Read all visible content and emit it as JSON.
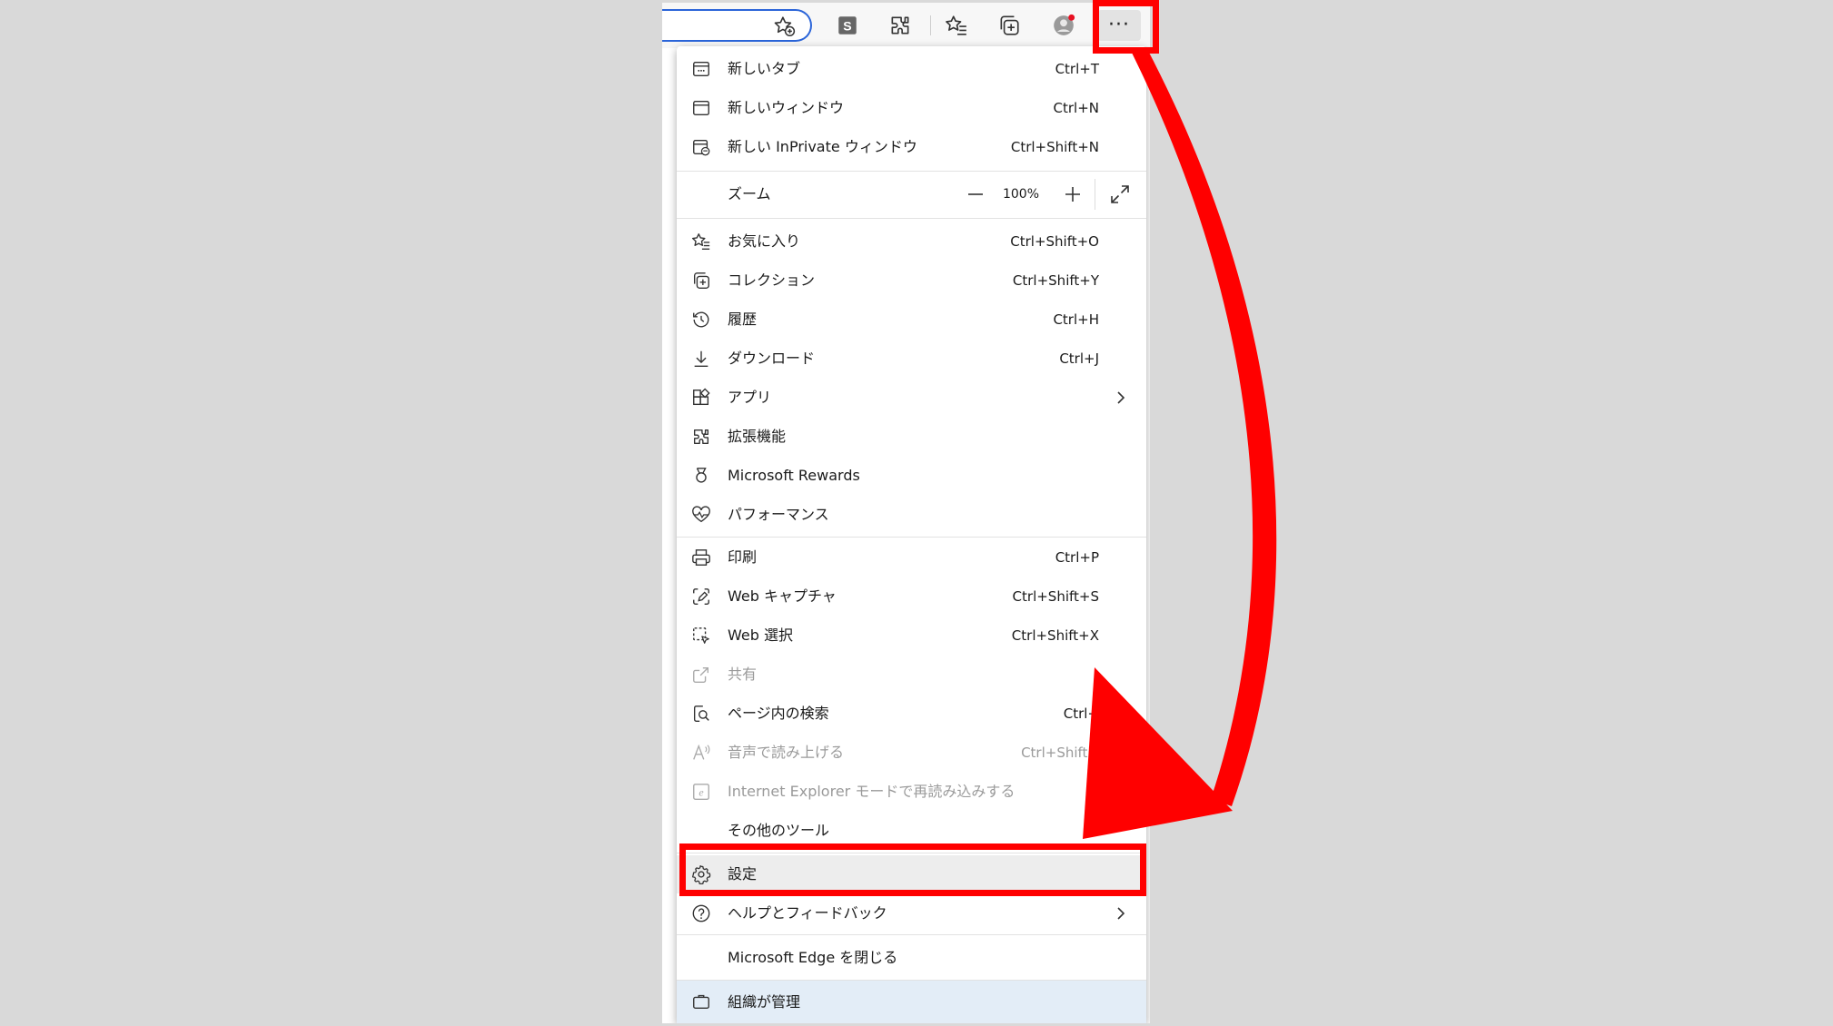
{
  "toolbar": {
    "icons": [
      "favorite-add-icon",
      "s-extension-icon",
      "extensions-icon",
      "favorites-icon",
      "collections-icon",
      "profile-icon",
      "more-icon"
    ],
    "more_label": "···"
  },
  "menu": {
    "new_tab": {
      "label": "新しいタブ",
      "shortcut": "Ctrl+T"
    },
    "new_window": {
      "label": "新しいウィンドウ",
      "shortcut": "Ctrl+N"
    },
    "inprivate": {
      "label": "新しい InPrivate ウィンドウ",
      "shortcut": "Ctrl+Shift+N"
    },
    "zoom": {
      "label": "ズーム",
      "value": "100%"
    },
    "favorites": {
      "label": "お気に入り",
      "shortcut": "Ctrl+Shift+O"
    },
    "collections": {
      "label": "コレクション",
      "shortcut": "Ctrl+Shift+Y"
    },
    "history": {
      "label": "履歴",
      "shortcut": "Ctrl+H"
    },
    "downloads": {
      "label": "ダウンロード",
      "shortcut": "Ctrl+J"
    },
    "apps": {
      "label": "アプリ"
    },
    "extensions": {
      "label": "拡張機能"
    },
    "rewards": {
      "label": "Microsoft Rewards"
    },
    "performance": {
      "label": "パフォーマンス"
    },
    "print": {
      "label": "印刷",
      "shortcut": "Ctrl+P"
    },
    "web_capture": {
      "label": "Web キャプチャ",
      "shortcut": "Ctrl+Shift+S"
    },
    "web_select": {
      "label": "Web 選択",
      "shortcut": "Ctrl+Shift+X"
    },
    "share": {
      "label": "共有"
    },
    "find": {
      "label": "ページ内の検索",
      "shortcut": "Ctrl+"
    },
    "read_aloud": {
      "label": "音声で読み上げる",
      "shortcut": "Ctrl+Shift+"
    },
    "ie_mode": {
      "label": "Internet Explorer モードで再読み込みする"
    },
    "more_tools": {
      "label": "その他のツール"
    },
    "settings": {
      "label": "設定"
    },
    "help": {
      "label": "ヘルプとフィードバック"
    },
    "close_edge": {
      "label": "Microsoft Edge を閉じる"
    },
    "managed": {
      "label": "組織が管理"
    }
  },
  "colors": {
    "highlight": "#ff0000",
    "address_border": "#2b65d9",
    "settings_bg": "#ededed",
    "managed_bg": "#e3edf7"
  }
}
